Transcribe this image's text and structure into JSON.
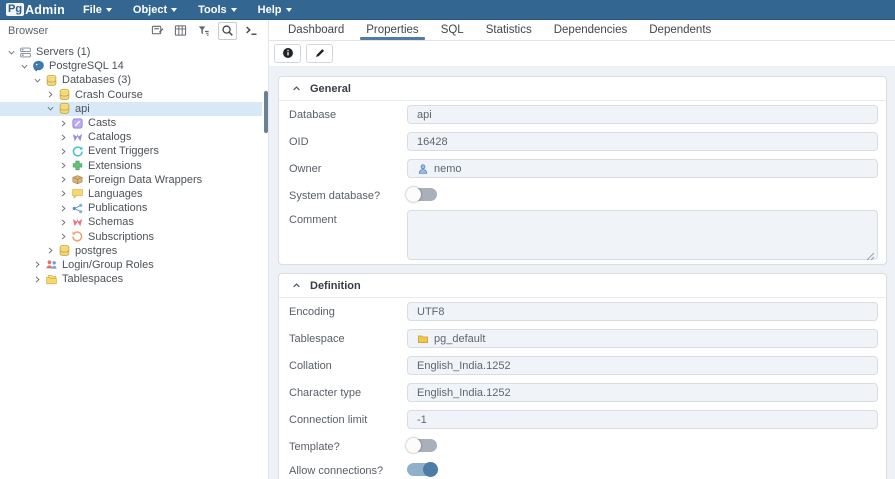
{
  "header": {
    "logo_pg": "Pg",
    "logo_admin": "Admin",
    "menus": [
      {
        "label": "File"
      },
      {
        "label": "Object"
      },
      {
        "label": "Tools"
      },
      {
        "label": "Help"
      }
    ]
  },
  "browser": {
    "title": "Browser",
    "toolbar_icons": [
      {
        "name": "add-object-icon"
      },
      {
        "name": "grid-icon"
      },
      {
        "name": "filter-icon"
      },
      {
        "name": "search-icon"
      },
      {
        "name": "query-tool-icon"
      }
    ],
    "tree": [
      {
        "label": "Servers (1)",
        "depth": 0,
        "caret": "expanded",
        "icon": "server-icon",
        "selected": false
      },
      {
        "label": "PostgreSQL 14",
        "depth": 1,
        "caret": "expanded",
        "icon": "postgresql-icon",
        "selected": false
      },
      {
        "label": "Databases (3)",
        "depth": 2,
        "caret": "expanded",
        "icon": "database-icon",
        "selected": false
      },
      {
        "label": "Crash Course",
        "depth": 3,
        "caret": "collapsed",
        "icon": "database-icon",
        "selected": false
      },
      {
        "label": "api",
        "depth": 3,
        "caret": "expanded",
        "icon": "database-icon",
        "selected": true
      },
      {
        "label": "Casts",
        "depth": 4,
        "caret": "collapsed",
        "icon": "casts-icon",
        "selected": false
      },
      {
        "label": "Catalogs",
        "depth": 4,
        "caret": "collapsed",
        "icon": "catalogs-icon",
        "selected": false
      },
      {
        "label": "Event Triggers",
        "depth": 4,
        "caret": "collapsed",
        "icon": "event-triggers-icon",
        "selected": false
      },
      {
        "label": "Extensions",
        "depth": 4,
        "caret": "collapsed",
        "icon": "extensions-icon",
        "selected": false
      },
      {
        "label": "Foreign Data Wrappers",
        "depth": 4,
        "caret": "collapsed",
        "icon": "fdw-icon",
        "selected": false
      },
      {
        "label": "Languages",
        "depth": 4,
        "caret": "collapsed",
        "icon": "languages-icon",
        "selected": false
      },
      {
        "label": "Publications",
        "depth": 4,
        "caret": "collapsed",
        "icon": "publications-icon",
        "selected": false
      },
      {
        "label": "Schemas",
        "depth": 4,
        "caret": "collapsed",
        "icon": "schemas-icon",
        "selected": false
      },
      {
        "label": "Subscriptions",
        "depth": 4,
        "caret": "collapsed",
        "icon": "subscriptions-icon",
        "selected": false
      },
      {
        "label": "postgres",
        "depth": 3,
        "caret": "collapsed",
        "icon": "database-icon",
        "selected": false
      },
      {
        "label": "Login/Group Roles",
        "depth": 2,
        "caret": "collapsed",
        "icon": "roles-icon",
        "selected": false
      },
      {
        "label": "Tablespaces",
        "depth": 2,
        "caret": "collapsed",
        "icon": "tablespaces-icon",
        "selected": false
      }
    ]
  },
  "main": {
    "tabs": [
      {
        "label": "Dashboard",
        "active": false
      },
      {
        "label": "Properties",
        "active": true
      },
      {
        "label": "SQL",
        "active": false
      },
      {
        "label": "Statistics",
        "active": false
      },
      {
        "label": "Dependencies",
        "active": false
      },
      {
        "label": "Dependents",
        "active": false
      }
    ],
    "toolbar": [
      {
        "name": "info-button",
        "icon": "info-icon"
      },
      {
        "name": "edit-button",
        "icon": "pencil-icon"
      }
    ],
    "sections": [
      {
        "title": "General",
        "rows": [
          {
            "label": "Database",
            "type": "input",
            "value": "api"
          },
          {
            "label": "OID",
            "type": "input",
            "value": "16428"
          },
          {
            "label": "Owner",
            "type": "input-icon",
            "icon": "user-icon",
            "value": "nemo"
          },
          {
            "label": "System database?",
            "type": "toggle",
            "state": "off"
          },
          {
            "label": "Comment",
            "type": "textarea",
            "value": ""
          }
        ]
      },
      {
        "title": "Definition",
        "rows": [
          {
            "label": "Encoding",
            "type": "input",
            "value": "UTF8"
          },
          {
            "label": "Tablespace",
            "type": "input-icon",
            "icon": "folder-icon",
            "value": "pg_default"
          },
          {
            "label": "Collation",
            "type": "input",
            "value": "English_India.1252"
          },
          {
            "label": "Character type",
            "type": "input",
            "value": "English_India.1252"
          },
          {
            "label": "Connection limit",
            "type": "input",
            "value": "-1"
          },
          {
            "label": "Template?",
            "type": "toggle",
            "state": "off"
          },
          {
            "label": "Allow connections?",
            "type": "toggle",
            "state": "on"
          }
        ]
      }
    ]
  },
  "colors": {
    "header_bg": "#336791",
    "tab_accent": "#4d7ca6",
    "selection_bg": "#d7e9f7",
    "toggle_on_knob": "#4d7ca6",
    "toggle_on_track": "#8fb0cb",
    "toggle_off_track": "#a9b0b9",
    "input_bg": "#f0f3f7",
    "content_bg": "#eef1f5"
  }
}
